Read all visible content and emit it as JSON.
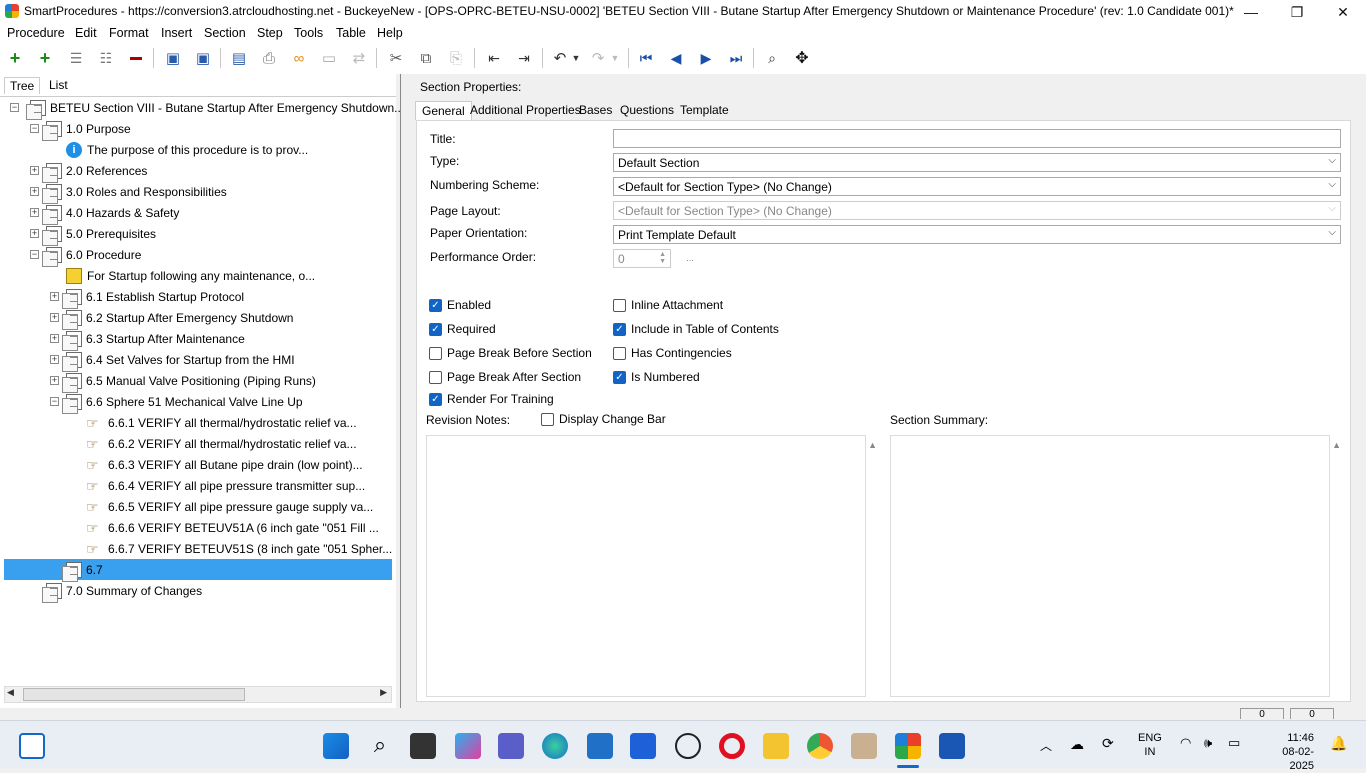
{
  "window": {
    "title": "SmartProcedures - https://conversion3.atrcloudhosting.net - BuckeyeNew - [OPS-OPRC-BETEU-NSU-0002] 'BETEU Section VIII - Butane Startup After Emergency Shutdown or Maintenance Procedure' (rev: 1.0 Candidate 001)*",
    "minimize": "—",
    "restore": "❐",
    "close": "✕"
  },
  "menu": [
    "Procedure",
    "Edit",
    "Format",
    "Insert",
    "Section",
    "Step",
    "Tools",
    "Table",
    "Help"
  ],
  "left_tabs": {
    "tree": "Tree",
    "list": "List"
  },
  "tree": [
    {
      "label": "BETEU Section VIII - Butane Startup After Emergency Shutdown...",
      "level": 0,
      "exp": "−",
      "icon": "doc"
    },
    {
      "label": "1.0 Purpose",
      "level": 1,
      "exp": "−",
      "icon": "doc"
    },
    {
      "label": "The purpose of this procedure is to prov...",
      "level": 2,
      "exp": "",
      "icon": "info"
    },
    {
      "label": "2.0 References",
      "level": 1,
      "exp": "+",
      "icon": "doc"
    },
    {
      "label": "3.0 Roles and Responsibilities",
      "level": 1,
      "exp": "+",
      "icon": "doc"
    },
    {
      "label": "4.0 Hazards & Safety",
      "level": 1,
      "exp": "+",
      "icon": "doc"
    },
    {
      "label": "5.0 Prerequisites",
      "level": 1,
      "exp": "+",
      "icon": "doc"
    },
    {
      "label": "6.0 Procedure",
      "level": 1,
      "exp": "−",
      "icon": "doc"
    },
    {
      "label": "For Startup following any maintenance, o...",
      "level": 2,
      "exp": "",
      "icon": "note"
    },
    {
      "label": "6.1 Establish Startup Protocol",
      "level": 2,
      "exp": "+",
      "icon": "doc"
    },
    {
      "label": "6.2 Startup After Emergency Shutdown",
      "level": 2,
      "exp": "+",
      "icon": "doc"
    },
    {
      "label": "6.3 Startup After Maintenance",
      "level": 2,
      "exp": "+",
      "icon": "doc"
    },
    {
      "label": "6.4 Set Valves for Startup from the HMI",
      "level": 2,
      "exp": "+",
      "icon": "doc"
    },
    {
      "label": "6.5 Manual Valve Positioning (Piping Runs)",
      "level": 2,
      "exp": "+",
      "icon": "doc"
    },
    {
      "label": "6.6 Sphere 51 Mechanical Valve Line Up",
      "level": 2,
      "exp": "−",
      "icon": "doc"
    },
    {
      "label": "6.6.1 VERIFY all thermal/hydrostatic relief va...",
      "level": 3,
      "exp": "",
      "icon": "step"
    },
    {
      "label": "6.6.2 VERIFY all thermal/hydrostatic relief va...",
      "level": 3,
      "exp": "",
      "icon": "step"
    },
    {
      "label": "6.6.3 VERIFY all Butane pipe drain (low point)...",
      "level": 3,
      "exp": "",
      "icon": "step"
    },
    {
      "label": "6.6.4 VERIFY all pipe pressure transmitter sup...",
      "level": 3,
      "exp": "",
      "icon": "step"
    },
    {
      "label": "6.6.5 VERIFY all pipe pressure gauge supply va...",
      "level": 3,
      "exp": "",
      "icon": "step"
    },
    {
      "label": "6.6.6 VERIFY BETEUV51A (6 inch gate \"051 Fill ...",
      "level": 3,
      "exp": "",
      "icon": "step"
    },
    {
      "label": "6.6.7 VERIFY BETEUV51S (8 inch gate \"051 Spher...",
      "level": 3,
      "exp": "",
      "icon": "step"
    },
    {
      "label": "6.7",
      "level": 2,
      "exp": "",
      "icon": "doc",
      "selected": true
    },
    {
      "label": "7.0 Summary of Changes",
      "level": 1,
      "exp": "",
      "icon": "doc"
    }
  ],
  "section_properties": {
    "heading": "Section Properties:",
    "tabs": [
      "General",
      "Additional Properties",
      "Bases",
      "Questions",
      "Template"
    ],
    "title_label": "Title:",
    "title_value": "",
    "type_label": "Type:",
    "type_value": "Default Section",
    "numbering_label": "Numbering Scheme:",
    "numbering_value": "<Default for Section Type> (No Change)",
    "layout_label": "Page Layout:",
    "layout_value": "<Default for Section Type> (No Change)",
    "orientation_label": "Paper Orientation:",
    "orientation_value": "Print Template Default",
    "perf_label": "Performance Order:",
    "perf_value": "0",
    "perf_btn": "...",
    "checkboxes_left": [
      {
        "label": "Enabled",
        "checked": true
      },
      {
        "label": "Required",
        "checked": true
      },
      {
        "label": "Page Break Before Section",
        "checked": false
      },
      {
        "label": "Page Break After Section",
        "checked": false
      },
      {
        "label": "Render For Training",
        "checked": true
      }
    ],
    "checkboxes_right": [
      {
        "label": "Inline Attachment",
        "checked": false
      },
      {
        "label": "Include in Table of Contents",
        "checked": true
      },
      {
        "label": "Has Contingencies",
        "checked": false
      },
      {
        "label": "Is Numbered",
        "checked": true
      }
    ],
    "revision_notes_label": "Revision Notes:",
    "display_change_bar": {
      "label": "Display Change Bar",
      "checked": false
    },
    "summary_label": "Section Summary:"
  },
  "status": {
    "left_val": "0",
    "right_val": "0"
  },
  "taskbar": {
    "lang": "ENG",
    "region": "IN",
    "time": "11:46",
    "date": "08-02-2025"
  }
}
